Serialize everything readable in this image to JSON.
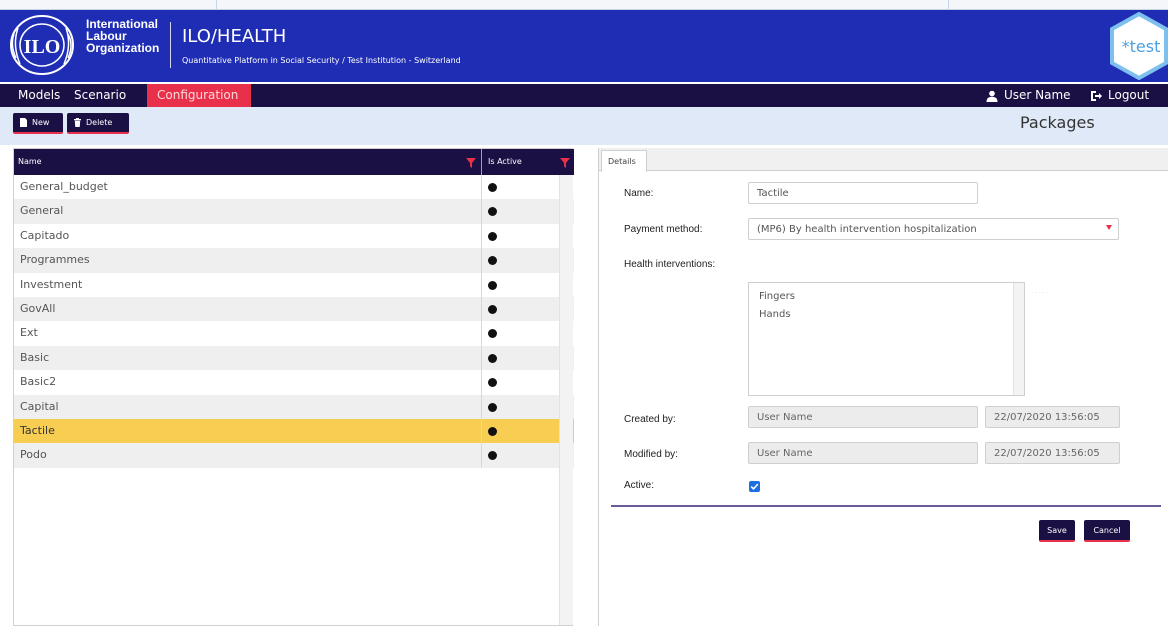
{
  "header": {
    "org_name_lines": [
      "International",
      "Labour",
      "Organization"
    ],
    "app_title": "ILO/HEALTH",
    "app_subtitle": "Quantitative Platform in Social Security / Test Institution - Switzerland",
    "badge_text": "*test",
    "badge_color": "#4aa0e0"
  },
  "nav": {
    "items": [
      {
        "label": "Models"
      },
      {
        "label": "Scenario"
      },
      {
        "label": "Configuration",
        "active": true
      }
    ],
    "user_label": "User Name",
    "logout_label": "Logout"
  },
  "toolbar": {
    "new_label": "New",
    "delete_label": "Delete",
    "page_title": "Packages"
  },
  "grid": {
    "columns": [
      "Name",
      "Is Active"
    ],
    "rows": [
      {
        "name": "General_budget",
        "active": true
      },
      {
        "name": "General",
        "active": true
      },
      {
        "name": "Capitado",
        "active": true
      },
      {
        "name": "Programmes",
        "active": true
      },
      {
        "name": "Investment",
        "active": true
      },
      {
        "name": "GovAll",
        "active": true
      },
      {
        "name": "Ext",
        "active": true
      },
      {
        "name": "Basic",
        "active": true
      },
      {
        "name": "Basic2",
        "active": true
      },
      {
        "name": "Capital",
        "active": true
      },
      {
        "name": "Tactile",
        "active": true,
        "selected": true
      },
      {
        "name": "Podo",
        "active": true
      }
    ]
  },
  "details": {
    "tab_label": "Details",
    "name_label": "Name:",
    "name_value": "Tactile",
    "payment_label": "Payment method:",
    "payment_value": "(MP6) By health intervention hospitalization",
    "health_label": "Health interventions:",
    "health_items": [
      "Fingers",
      "Hands"
    ],
    "created_label": "Created by:",
    "created_by": "User Name",
    "created_at": "22/07/2020 13:56:05",
    "modified_label": "Modified by:",
    "modified_by": "User Name",
    "modified_at": "22/07/2020 13:56:05",
    "active_label": "Active:",
    "active_checked": true,
    "save_label": "Save",
    "cancel_label": "Cancel"
  },
  "colors": {
    "header_blue": "#1e2db4",
    "nav_dark": "#1a1044",
    "accent_red": "#e8304a",
    "selected_row": "#f8ce52",
    "toolbar_bg": "#dfe9f7",
    "checkbox_blue": "#1c6fe0"
  }
}
